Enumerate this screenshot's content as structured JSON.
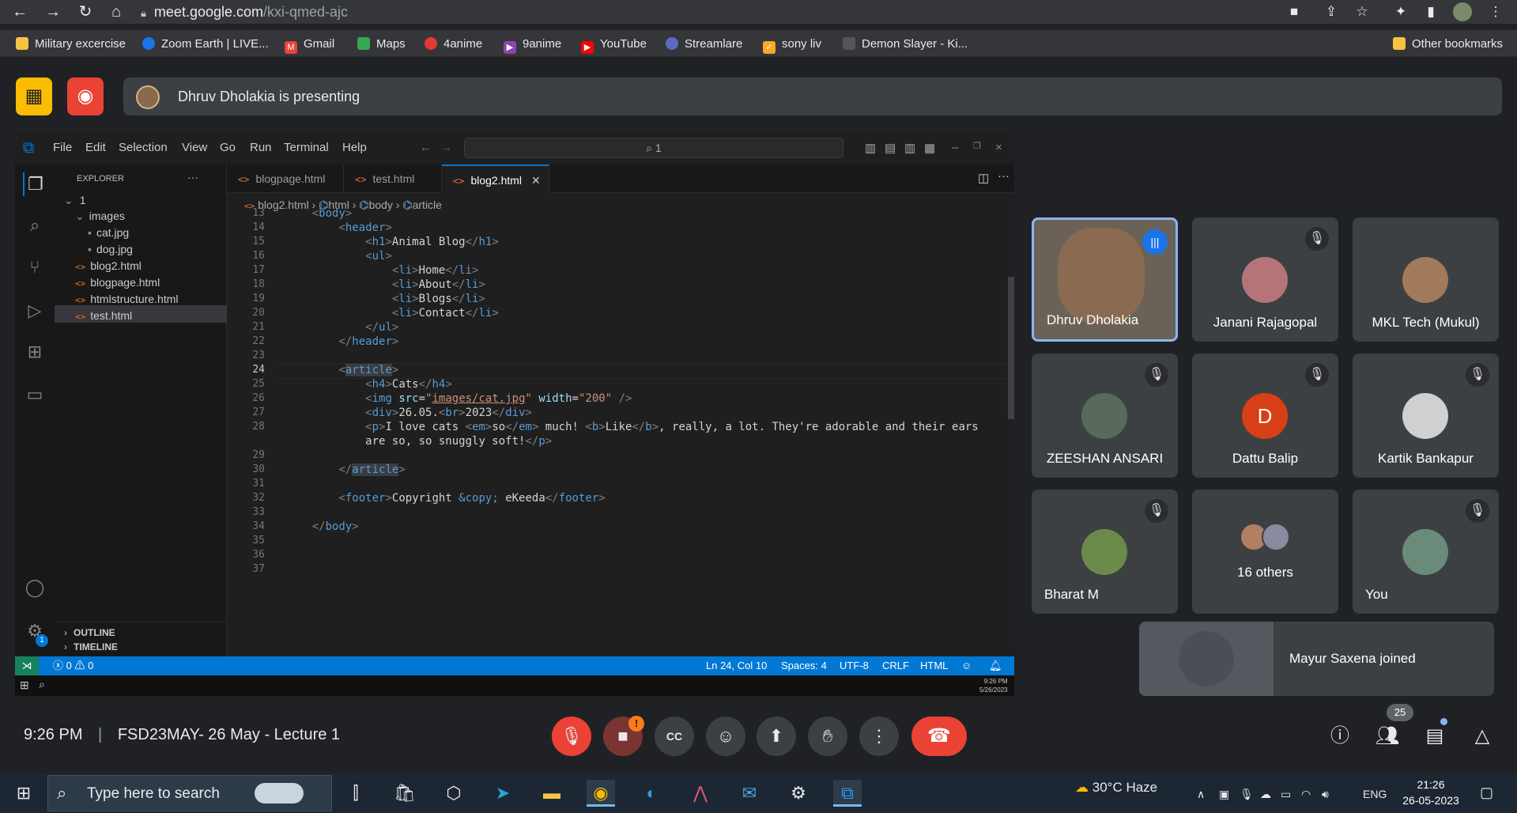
{
  "browser": {
    "url_host": "meet.google.com",
    "url_path": "/kxi-qmed-ajc",
    "bookmarks": [
      {
        "label": "Military excercise",
        "color": "#f4c542"
      },
      {
        "label": "Zoom Earth | LIVE...",
        "color": "#1a73e8"
      },
      {
        "label": "Gmail",
        "color": "#ea4335"
      },
      {
        "label": "Maps",
        "color": "#34a853"
      },
      {
        "label": "4anime",
        "color": "#e53935"
      },
      {
        "label": "9anime",
        "color": "#8e44ad"
      },
      {
        "label": "YouTube",
        "color": "#ff0000"
      },
      {
        "label": "Streamlare",
        "color": "#5c6bc0"
      },
      {
        "label": "sony liv",
        "color": "#f9a825"
      },
      {
        "label": "Demon Slayer - Ki...",
        "color": "#555555"
      }
    ],
    "other_bookmarks": "Other bookmarks"
  },
  "meet": {
    "presenting_text": "Dhruv Dholakia is presenting",
    "meeting_time": "9:26 PM",
    "separator": "|",
    "meeting_title": "FSD23MAY- 26 May - Lecture 1",
    "participant_count": "25",
    "joined_text": "Mayur Saxena joined",
    "participants": [
      {
        "name": "Dhruv Dholakia",
        "speaking": true
      },
      {
        "name": "Janani Rajagopal",
        "muted": true
      },
      {
        "name": "MKL Tech (Mukul)",
        "muted": false
      },
      {
        "name": "ZEESHAN ANSARI",
        "muted": true
      },
      {
        "name": "Dattu Balip",
        "muted": true,
        "initial": "D",
        "avatar_color": "#d93f16"
      },
      {
        "name": "Kartik Bankapur",
        "muted": true
      },
      {
        "name": "Bharat M",
        "muted": true
      },
      {
        "name": "16 others"
      },
      {
        "name": "You",
        "muted": true
      }
    ],
    "alert_badge": "!"
  },
  "vscode": {
    "menu": [
      "File",
      "Edit",
      "Selection",
      "View",
      "Go",
      "Run",
      "Terminal",
      "Help"
    ],
    "search_text": "1",
    "explorer_title": "EXPLORER",
    "explorer_more": "···",
    "folder": "1",
    "subfolder": "images",
    "files_images": [
      "cat.jpg",
      "dog.jpg"
    ],
    "files": [
      "blog2.html",
      "blogpage.html",
      "htmlstructure.html",
      "test.html"
    ],
    "outline": "OUTLINE",
    "timeline": "TIMELINE",
    "tabs": [
      "blogpage.html",
      "test.html",
      "blog2.html"
    ],
    "tab_close": "✕",
    "breadcrumb": [
      "blog2.html",
      "html",
      "body",
      "article"
    ],
    "line_numbers": [
      "13",
      "14",
      "15",
      "16",
      "17",
      "18",
      "19",
      "20",
      "21",
      "22",
      "23",
      "24",
      "25",
      "26",
      "27",
      "28",
      "",
      "29",
      "30",
      "31",
      "32",
      "33",
      "34",
      "35",
      "36",
      "37"
    ],
    "status": {
      "errors": "0",
      "warnings": "0",
      "position": "Ln 24, Col 10",
      "spaces": "Spaces: 4",
      "encoding": "UTF-8",
      "eol": "CRLF",
      "language": "HTML",
      "settings_badge": "1"
    },
    "inner_clock": "9:26 PM",
    "inner_date": "5/26/2023"
  },
  "windows": {
    "search_placeholder": "Type here to search",
    "weather": "30°C  Haze",
    "lang": "ENG",
    "time": "21:26",
    "date": "26-05-2023"
  },
  "colors": {
    "accent": "#0078d4",
    "meet_red": "#ea4335",
    "meet_yellow": "#fbbc04"
  }
}
